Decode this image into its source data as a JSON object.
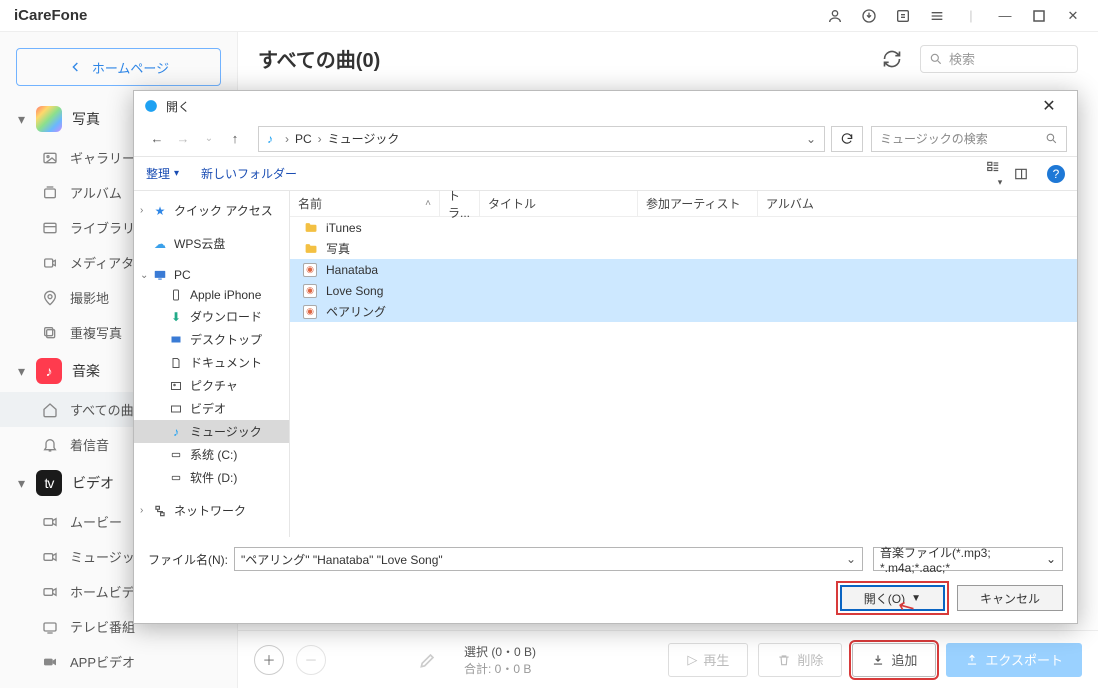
{
  "app": {
    "title": "iCareFone"
  },
  "titlebar_icons": [
    "user-icon",
    "download-circle-icon",
    "transfer-icon",
    "menu-icon",
    "divider",
    "minimize-icon",
    "maximize-icon",
    "close-icon"
  ],
  "sidebar": {
    "home_label": "ホームページ",
    "sections": [
      {
        "key": "photos",
        "label": "写真",
        "items": [
          {
            "label": "ギャラリー",
            "icon": "image-icon"
          },
          {
            "label": "アルバム",
            "icon": "album-icon"
          },
          {
            "label": "ライブラリ",
            "icon": "library-icon"
          },
          {
            "label": "メディアタイプ",
            "icon": "mediatype-icon"
          },
          {
            "label": "撮影地",
            "icon": "location-icon"
          },
          {
            "label": "重複写真",
            "icon": "duplicate-icon"
          }
        ]
      },
      {
        "key": "music",
        "label": "音楽",
        "items": [
          {
            "label": "すべての曲",
            "icon": "home-icon",
            "active": true
          },
          {
            "label": "着信音",
            "icon": "bell-icon"
          }
        ]
      },
      {
        "key": "video",
        "label": "ビデオ",
        "items": [
          {
            "label": "ムービー",
            "icon": "camera-icon"
          },
          {
            "label": "ミュージック",
            "icon": "camera-icon"
          },
          {
            "label": "ホームビデオ",
            "icon": "camera-icon"
          },
          {
            "label": "テレビ番組",
            "icon": "tv-icon"
          },
          {
            "label": "APPビデオ",
            "icon": "camera-solid-icon"
          }
        ]
      }
    ]
  },
  "content": {
    "heading": "すべての曲(0)",
    "search_placeholder": "検索"
  },
  "bottom": {
    "select_line": "選択 (0・0 B)",
    "total_line": "合計: 0・0 B",
    "play": "再生",
    "delete": "削除",
    "add": "追加",
    "export": "エクスポート"
  },
  "dialog": {
    "title": "開く",
    "path": {
      "root": "PC",
      "folder": "ミュージック"
    },
    "search_placeholder": "ミュージックの検索",
    "organize": "整理",
    "new_folder": "新しいフォルダー",
    "columns": {
      "name": "名前",
      "track": "トラ...",
      "title": "タイトル",
      "artist": "参加アーティスト",
      "album": "アルバム"
    },
    "tree": [
      {
        "label": "クイック アクセス",
        "icon": "star-icon",
        "lvl": 0,
        "exp": "›"
      },
      {
        "label": "WPS云盘",
        "icon": "cloud-icon",
        "lvl": 0
      },
      {
        "label": "PC",
        "icon": "monitor-icon",
        "lvl": 0,
        "exp": "⌄"
      },
      {
        "label": "Apple iPhone",
        "icon": "phone-icon",
        "lvl": 1
      },
      {
        "label": "ダウンロード",
        "icon": "download-icon",
        "lvl": 1
      },
      {
        "label": "デスクトップ",
        "icon": "desktop-icon",
        "lvl": 1
      },
      {
        "label": "ドキュメント",
        "icon": "document-icon",
        "lvl": 1
      },
      {
        "label": "ピクチャ",
        "icon": "picture-icon",
        "lvl": 1
      },
      {
        "label": "ビデオ",
        "icon": "video-icon",
        "lvl": 1
      },
      {
        "label": "ミュージック",
        "icon": "music-icon",
        "lvl": 1,
        "sel": true
      },
      {
        "label": "系统 (C:)",
        "icon": "drive-icon",
        "lvl": 1
      },
      {
        "label": "软件 (D:)",
        "icon": "drive-icon",
        "lvl": 1
      },
      {
        "label": "ネットワーク",
        "icon": "network-icon",
        "lvl": 0,
        "exp": "›"
      }
    ],
    "files": [
      {
        "name": "iTunes",
        "type": "folder"
      },
      {
        "name": "写真",
        "type": "folder"
      },
      {
        "name": "Hanataba",
        "type": "audio",
        "sel": true
      },
      {
        "name": "Love Song",
        "type": "audio",
        "sel": true
      },
      {
        "name": "ペアリング",
        "type": "audio",
        "sel": true
      }
    ],
    "filename_label": "ファイル名(N):",
    "filename_value": "\"ペアリング\" \"Hanataba\" \"Love Song\"",
    "filter": "音楽ファイル(*.mp3; *.m4a;*.aac;*",
    "open_btn": "開く(O)",
    "cancel_btn": "キャンセル"
  }
}
